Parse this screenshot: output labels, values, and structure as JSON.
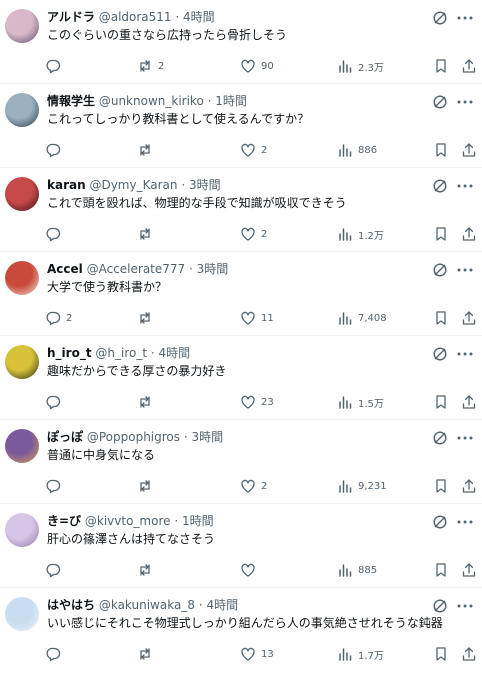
{
  "replies": [
    {
      "name": "アルドラ",
      "handle": "@aldora511",
      "time": "4時間",
      "text": "このぐらいの重さなら広持ったら骨折しそう",
      "replies": "",
      "retweets": "2",
      "likes": "90",
      "views": "2.3万",
      "avatar_colors": [
        "#d9b9c9",
        "#5a4a6a"
      ]
    },
    {
      "name": "情報学生",
      "handle": "@unknown_kiriko",
      "time": "1時間",
      "text": "これってしっかり教科書として使えるんですか？",
      "replies": "",
      "retweets": "",
      "likes": "2",
      "views": "886",
      "avatar_colors": [
        "#9bb1bf",
        "#2a3a48"
      ]
    },
    {
      "name": "karan",
      "handle": "@Dymy_Karan",
      "time": "3時間",
      "text": "これで頭を殴れば、物理的な手段で知識が吸収できそう",
      "replies": "",
      "retweets": "",
      "likes": "2",
      "views": "1.2万",
      "avatar_colors": [
        "#c74a4a",
        "#3a1010"
      ]
    },
    {
      "name": "Accel",
      "handle": "@Accelerate777",
      "time": "3時間",
      "text": "大学で使う教科書か？",
      "replies": "2",
      "retweets": "",
      "likes": "11",
      "views": "7,408",
      "avatar_colors": [
        "#c94a3a",
        "#f1e6dd"
      ]
    },
    {
      "name": "h_iro_t",
      "handle": "@h_iro_t",
      "time": "4時間",
      "text": "趣味だからできる厚さの暴力好き",
      "replies": "",
      "retweets": "",
      "likes": "23",
      "views": "1.5万",
      "avatar_colors": [
        "#d8c23a",
        "#2a2a1a"
      ]
    },
    {
      "name": "ぽっぽ",
      "handle": "@Poppophigros",
      "time": "3時間",
      "text": "普通に中身気になる",
      "replies": "",
      "retweets": "",
      "likes": "2",
      "views": "9,231",
      "avatar_colors": [
        "#7a5a9a",
        "#e0a050"
      ]
    },
    {
      "name": "き=び",
      "handle": "@kivvto_more",
      "time": "1時間",
      "text": "肝心の篠澤さんは持てなさそう",
      "replies": "",
      "retweets": "",
      "likes": "",
      "views": "885",
      "avatar_colors": [
        "#d7c7e6",
        "#8e7aa8"
      ]
    },
    {
      "name": "はやはち",
      "handle": "@kakuniwaka_8",
      "time": "4時間",
      "text": "いい感じにそれこそ物理式しっかり組んだら人の事気絶させれそうな鈍器",
      "replies": "",
      "retweets": "",
      "likes": "13",
      "views": "1.7万",
      "avatar_colors": [
        "#c9ddf0",
        "#eaf2fb"
      ]
    }
  ]
}
